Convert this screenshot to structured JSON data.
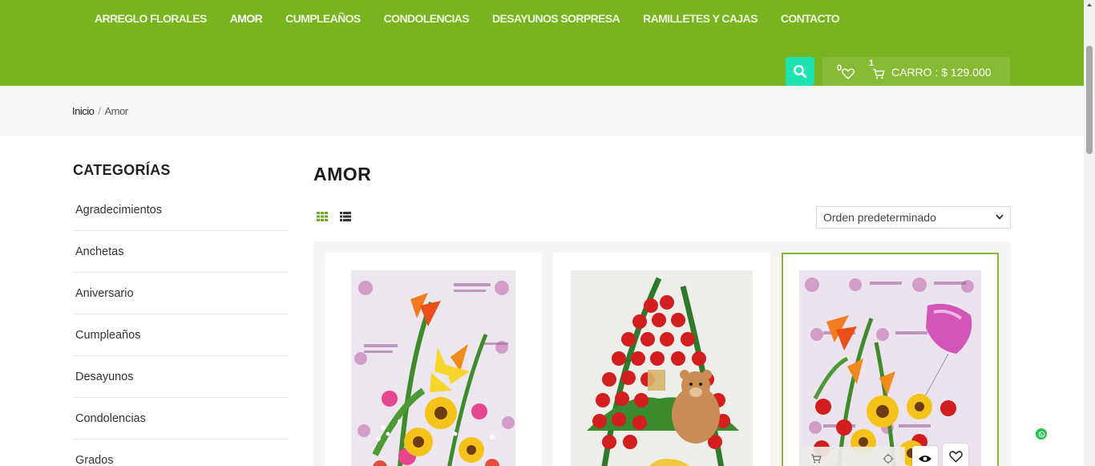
{
  "nav": {
    "items": [
      {
        "label": "ARREGLO FLORALES",
        "active": false
      },
      {
        "label": "AMOR",
        "active": true
      },
      {
        "label": "CUMPLEAÑOS",
        "active": false
      },
      {
        "label": "CONDOLENCIAS",
        "active": false
      },
      {
        "label": "DESAYUNOS SORPRESA",
        "active": false
      },
      {
        "label": "RAMILLETES Y CAJAS",
        "active": false
      },
      {
        "label": "CONTACTO",
        "active": false
      }
    ]
  },
  "header": {
    "wishlist_count": "0",
    "cart_count": "1",
    "cart_label": "CARRO : $ 129.000"
  },
  "breadcrumb": {
    "home": "Inicio",
    "separator": "/",
    "current": "Amor"
  },
  "sidebar": {
    "title": "CATEGORÍAS",
    "items": [
      {
        "label": "Agradecimientos"
      },
      {
        "label": "Anchetas"
      },
      {
        "label": "Aniversario"
      },
      {
        "label": "Cumpleaños"
      },
      {
        "label": "Desayunos"
      },
      {
        "label": "Condolencias"
      },
      {
        "label": "Grados"
      }
    ]
  },
  "main": {
    "title": "AMOR",
    "sort_selected": "Orden predeterminado"
  },
  "colors": {
    "header_green": "#77b41f",
    "search_teal": "#20e3b2",
    "hover_border": "#82b833"
  },
  "icons": [
    "search-icon",
    "heart-icon",
    "cart-icon",
    "grid-view-icon",
    "list-view-icon",
    "chevron-down-icon",
    "eye-icon",
    "compare-icon",
    "whatsapp-icon"
  ]
}
